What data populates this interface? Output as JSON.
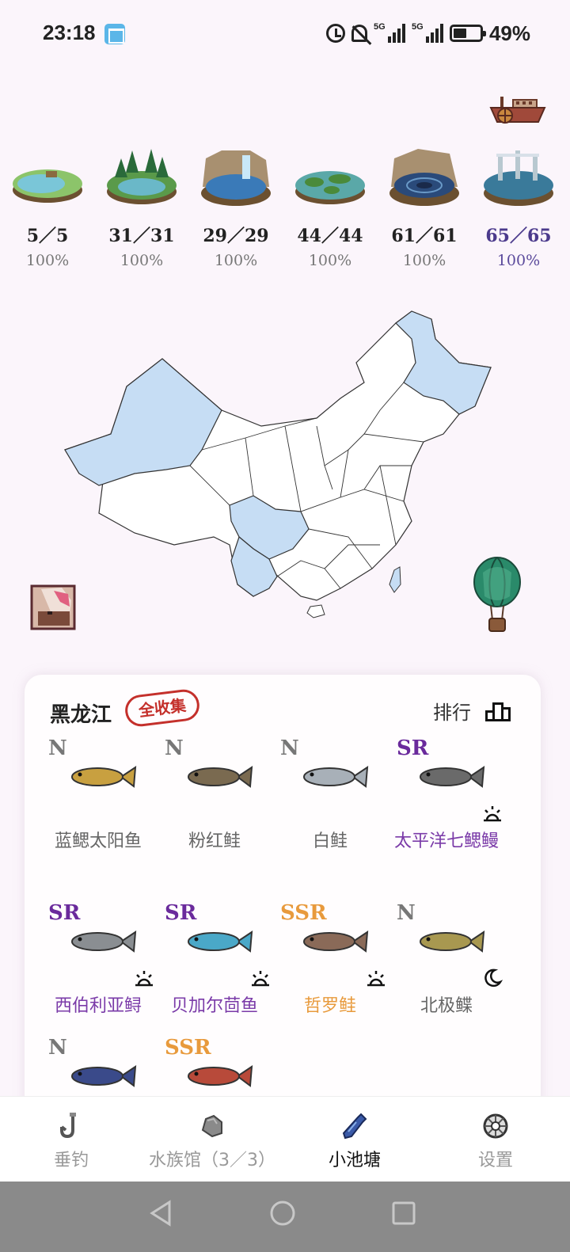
{
  "status_bar": {
    "time": "23:18",
    "signal1": "5G",
    "signal2": "5G",
    "battery": "49%"
  },
  "dioramas": [
    {
      "count": "5／5",
      "percent": "100%",
      "theme": "pond"
    },
    {
      "count": "31／31",
      "percent": "100%",
      "theme": "forest-lake"
    },
    {
      "count": "29／29",
      "percent": "100%",
      "theme": "waterfall"
    },
    {
      "count": "44／44",
      "percent": "100%",
      "theme": "islands"
    },
    {
      "count": "61／61",
      "percent": "100%",
      "theme": "whirlpool"
    },
    {
      "count": "65／65",
      "percent": "100%",
      "theme": "ruins",
      "active": true
    }
  ],
  "card": {
    "region": "黑龙江",
    "badge": "全收集",
    "rank_label": "排行",
    "fish": [
      {
        "rarity": "N",
        "name": "蓝鳃太阳鱼",
        "condition": "",
        "color": "#c8a040"
      },
      {
        "rarity": "N",
        "name": "粉红鲑",
        "condition": "",
        "color": "#7a6a50"
      },
      {
        "rarity": "N",
        "name": "白鲑",
        "condition": "",
        "color": "#a8b0b8"
      },
      {
        "rarity": "SR",
        "name": "太平洋七鳃鳗",
        "condition": "sun-icon",
        "color": "#6a6a6a"
      },
      {
        "rarity": "SR",
        "name": "西伯利亚鲟",
        "condition": "sun-icon",
        "color": "#8a8e92"
      },
      {
        "rarity": "SR",
        "name": "贝加尔茴鱼",
        "condition": "sun-icon",
        "color": "#4aa8c8"
      },
      {
        "rarity": "SSR",
        "name": "哲罗鲑",
        "condition": "sun-icon",
        "color": "#8a6a58"
      },
      {
        "rarity": "N",
        "name": "北极鲽",
        "condition": "moon-icon",
        "color": "#a89850"
      },
      {
        "rarity": "N",
        "name": "",
        "condition": "",
        "color": "#3a4a8a"
      },
      {
        "rarity": "SSR",
        "name": "",
        "condition": "",
        "color": "#b84a3a"
      }
    ]
  },
  "nav": {
    "items": [
      {
        "label": "垂钓",
        "icon": "hook-icon"
      },
      {
        "label": "水族馆（3／3）",
        "icon": "rock-icon"
      },
      {
        "label": "小池塘",
        "icon": "bottle-icon",
        "active": true
      },
      {
        "label": "设置",
        "icon": "settings-icon"
      }
    ]
  },
  "map": {
    "highlighted_regions": [
      "新疆",
      "黑龙江",
      "四川",
      "云南",
      "台湾"
    ]
  }
}
